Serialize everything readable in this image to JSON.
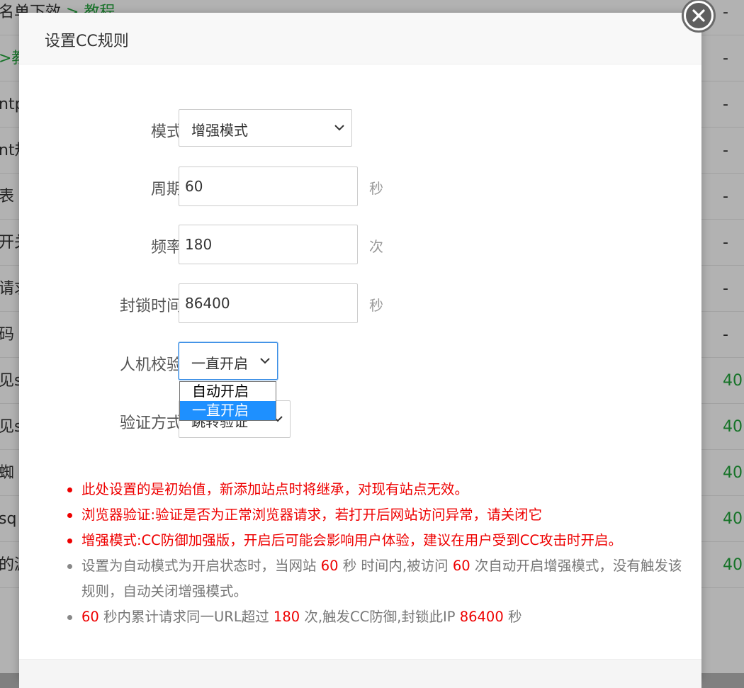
{
  "background": {
    "rows": [
      {
        "left_prefix": "名单下效 ",
        "left_green": "> 教程",
        "right": "-"
      },
      {
        "left_prefix": "",
        "left_green": ">教",
        "right": "-"
      },
      {
        "left_prefix": "ntp",
        "left_green": "",
        "right": "-"
      },
      {
        "left_prefix": "nt规",
        "left_green": "",
        "right": "-"
      },
      {
        "left_prefix": "表 ",
        "left_green": ">",
        "right": "-"
      },
      {
        "left_prefix": "开关",
        "left_green": "",
        "right": "-"
      },
      {
        "left_prefix": "请求",
        "left_green": "",
        "right": "-"
      },
      {
        "left_prefix": "码",
        "left_green": "",
        "right": "-"
      },
      {
        "left_prefix": "见s",
        "left_green": "",
        "right": "40"
      },
      {
        "left_prefix": "见s",
        "left_green": "",
        "right": "40"
      },
      {
        "left_prefix": " 蜘",
        "left_green": "",
        "right": "40"
      },
      {
        "left_prefix": "sq",
        "left_green": "",
        "right": "40"
      },
      {
        "left_prefix": "的漏",
        "left_green": "",
        "right": "40"
      }
    ]
  },
  "dialog": {
    "title": "设置CC规则",
    "close_icon": "close-icon"
  },
  "form": {
    "mode": {
      "label": "模式",
      "value": "增强模式"
    },
    "period": {
      "label": "周期",
      "value": "60",
      "unit": "秒"
    },
    "frequency": {
      "label": "频率",
      "value": "180",
      "unit": "次"
    },
    "block_time": {
      "label": "封锁时间",
      "value": "86400",
      "unit": "秒"
    },
    "captcha": {
      "label": "人机校验",
      "value": "一直开启",
      "options": [
        "自动开启",
        "一直开启"
      ],
      "selected_index": 1
    },
    "verify_method": {
      "label": "验证方式",
      "value": "跳转验证"
    }
  },
  "notes": {
    "red": [
      "此处设置的是初始值，新添加站点时将继承，对现有站点无效。",
      "浏览器验证:验证是否为正常浏览器请求，若打开后网站访问异常，请关闭它",
      "增强模式:CC防御加强版，开启后可能会影响用户体验，建议在用户受到CC攻击时开启。"
    ],
    "auto_mode": {
      "p1": "设置为自动模式为开启状态时，当网站 ",
      "v1": "60",
      "p2": " 秒 时间内,被访问 ",
      "v2": "60",
      "p3": " 次自动开启增强模式，没有触发该规则，自动关闭增强模式。"
    },
    "summary": {
      "v1": "60",
      "p1": " 秒内累计请求同一URL超过 ",
      "v2": "180",
      "p2": " 次,触发CC防御,封锁此IP ",
      "v3": "86400",
      "p3": " 秒"
    }
  },
  "colors": {
    "accent_red": "#ee0000",
    "brand_green": "#20a53a",
    "focus_blue": "#3a8ee6",
    "option_selected": "#1e90ff"
  }
}
